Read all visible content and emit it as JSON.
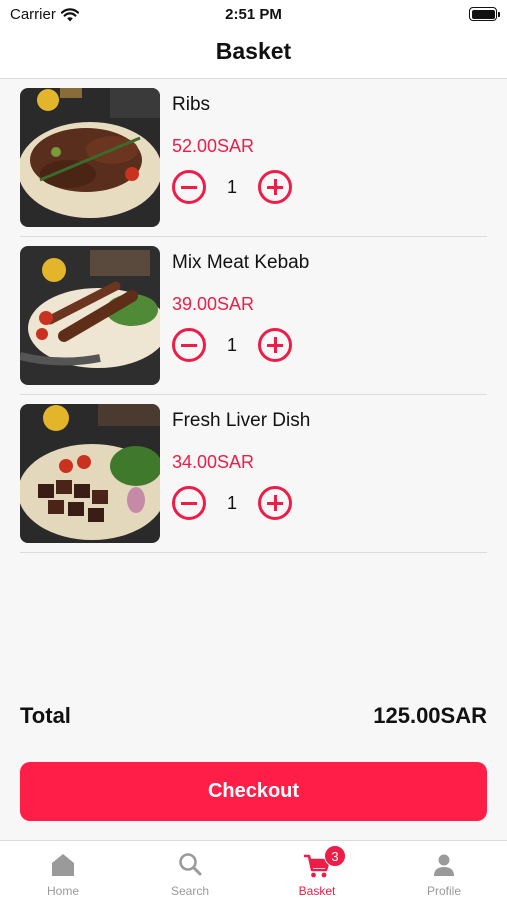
{
  "status_bar": {
    "carrier": "Carrier",
    "time": "2:51 PM"
  },
  "header": {
    "title": "Basket"
  },
  "items": [
    {
      "name": "Ribs",
      "price": "52.00SAR",
      "quantity": "1",
      "image": "ribs-photo"
    },
    {
      "name": "Mix Meat Kebab",
      "price": "39.00SAR",
      "quantity": "1",
      "image": "kebab-photo"
    },
    {
      "name": "Fresh Liver Dish",
      "price": "34.00SAR",
      "quantity": "1",
      "image": "liver-photo"
    }
  ],
  "summary": {
    "total_label": "Total",
    "total_value": "125.00SAR"
  },
  "checkout": {
    "label": "Checkout"
  },
  "tabs": [
    {
      "label": "Home",
      "icon": "home-icon"
    },
    {
      "label": "Search",
      "icon": "search-icon"
    },
    {
      "label": "Basket",
      "icon": "cart-icon",
      "badge": "3",
      "active": true
    },
    {
      "label": "Profile",
      "icon": "user-icon"
    }
  ],
  "colors": {
    "accent": "#ee1d48",
    "button": "#ff1e47",
    "inactive_tab": "#9a9a9a"
  }
}
